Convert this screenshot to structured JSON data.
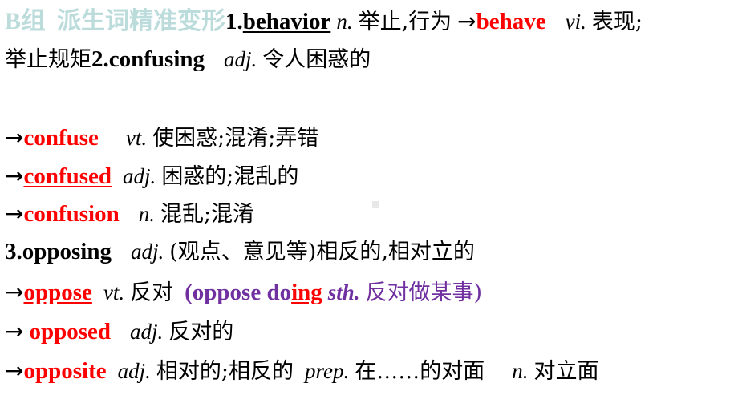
{
  "document": {
    "title": "B组 派生词精准变形",
    "colors": {
      "heading": "#bcdcdc",
      "red": "#ff0000",
      "purple": "#7030a0",
      "black": "#000000",
      "background": "#ffffff"
    }
  },
  "heading": {
    "group_tag": "B组",
    "group_label": "派生词精准变形"
  },
  "entries": [
    {
      "number": "1.",
      "headword": "behavior",
      "pos": "n.",
      "meaning": "举止,行为",
      "arrow": "→",
      "derived": "behave",
      "derived_pos": "vi.",
      "derived_meaning": "表现;举止规矩"
    },
    {
      "number": "2.",
      "headword": "confusing",
      "pos": "adj.",
      "meaning": "令人困惑的"
    },
    {
      "arrow": "→",
      "headword": "confuse",
      "pos": "vt.",
      "meaning": "使困惑;混淆;弄错"
    },
    {
      "arrow": "→",
      "headword": "confused",
      "pos": "adj.",
      "meaning": "困惑的;混乱的"
    },
    {
      "arrow": "→",
      "headword": "confusion",
      "pos": "n.",
      "meaning": "混乱;混淆"
    },
    {
      "number": "3.",
      "headword": "opposing",
      "pos": "adj.",
      "meaning": "(观点、意见等)相反的,相对立的"
    },
    {
      "arrow": "→",
      "headword": "oppose",
      "pos": "vt.",
      "meaning": "反对",
      "note_open": "(oppose do",
      "note_highlight": "ing",
      "note_abbr": "sth.",
      "note_cn": "反对做某事)"
    },
    {
      "arrow": "→",
      "headword": "opposed",
      "pos": "adj.",
      "meaning": "反对的"
    },
    {
      "arrow": "→",
      "headword": "opposite",
      "pos": "adj.",
      "meaning": "相对的;相反的",
      "pos2": "prep.",
      "meaning2": "在……的对面",
      "pos3": "n.",
      "meaning3": "对立面"
    }
  ],
  "lines": {
    "l1": {
      "tag": "B组",
      "label": "派生词精准变形",
      "num": "1.",
      "word": "behavior",
      "pos": "n.",
      "cn": "举止,行为",
      "arrow": "→",
      "word2": "behave",
      "pos2": "vi.",
      "cn2": "表现;"
    },
    "l2": {
      "cn": "举止规矩",
      "num": "2.",
      "word": "confusing",
      "pos": "adj.",
      "cn2": "令人困惑的"
    },
    "l3": {
      "arrow": "→",
      "word": "confuse",
      "pos": "vt.",
      "cn": "使困惑;混淆;弄错"
    },
    "l4": {
      "arrow": "→",
      "word": "confused",
      "pos": "adj.",
      "cn": "困惑的;混乱的"
    },
    "l5": {
      "arrow": "→",
      "word": "confusion",
      "pos": "n.",
      "cn": "混乱;混淆"
    },
    "l6": {
      "num": "3.",
      "word": "opposing",
      "pos": "adj.",
      "cn": "(观点、意见等)相反的,相对立的"
    },
    "l7": {
      "arrow": "→",
      "word": "oppose",
      "pos": "vt.",
      "cn": "反对",
      "note_a": "(oppose do",
      "note_b": "ing",
      "note_c": "sth.",
      "note_d": "反对做某事)"
    },
    "l8": {
      "arrow": "→",
      "word": "opposed",
      "pos": "adj.",
      "cn": "反对的"
    },
    "l9": {
      "arrow": "→",
      "word": "opposite",
      "pos": "adj.",
      "cn": "相对的;相反的",
      "pos2": "prep.",
      "cn2": "在……的对面",
      "pos3": "n.",
      "cn3": "对立面"
    }
  }
}
